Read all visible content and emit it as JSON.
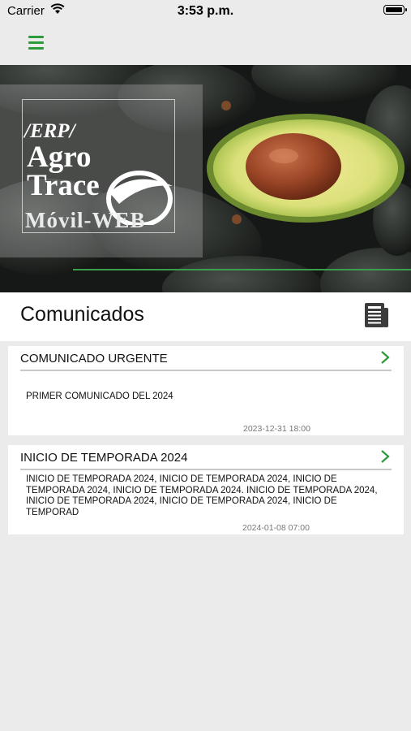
{
  "status_bar": {
    "carrier": "Carrier",
    "time": "3:53 p.m."
  },
  "nav": {
    "menu_icon": "hamburger-menu-icon",
    "accent": "#2d9b3a"
  },
  "banner": {
    "logo_erp": "/ERP/",
    "logo_agro": "Agro",
    "logo_trace": "Trace",
    "logo_movil": "Móvil-WEB"
  },
  "section": {
    "title": "Comunicados",
    "icon": "newspaper-icon"
  },
  "comunicados": [
    {
      "title": "COMUNICADO URGENTE",
      "body": "PRIMER COMUNICADO DEL 2024",
      "date": "2023-12-31 18:00"
    },
    {
      "title": "INICIO DE TEMPORADA 2024",
      "body": "INICIO DE TEMPORADA 2024, INICIO DE TEMPORADA 2024, INICIO DE TEMPORADA 2024, INICIO DE TEMPORADA 2024. INICIO DE TEMPORADA 2024, INICIO DE TEMPORADA 2024, INICIO DE TEMPORADA 2024, INICIO DE TEMPORAD",
      "date": "2024-01-08 07:00"
    }
  ]
}
